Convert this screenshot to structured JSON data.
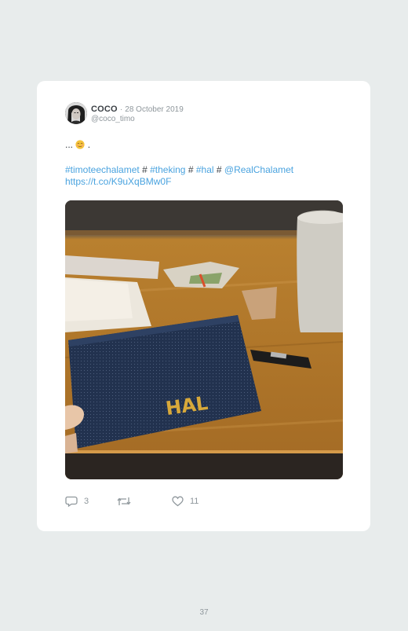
{
  "tweet": {
    "author": "COCO",
    "date_separator": "·",
    "date": "28 October 2019",
    "handle": "@coco_timo",
    "text_prefix": "...",
    "text_suffix": ".",
    "hashtags": [
      "#timoteechalamet",
      "#theking",
      "#hal"
    ],
    "separator": "#",
    "mention": "@RealChalamet",
    "link": "https://t.co/K9uXqBMw0F",
    "emoji_icon": "relieved-face-icon",
    "photo_text": "HAL"
  },
  "actions": {
    "reply_count": "3",
    "retweet_count": "",
    "like_count": "11",
    "icons": [
      "reply-icon",
      "retweet-icon",
      "heart-icon"
    ]
  },
  "page": {
    "number": "37"
  },
  "colors": {
    "background": "#e8ecec",
    "card": "#ffffff",
    "link": "#4aa3df",
    "muted": "#8f979c",
    "text": "#3a3f44"
  }
}
